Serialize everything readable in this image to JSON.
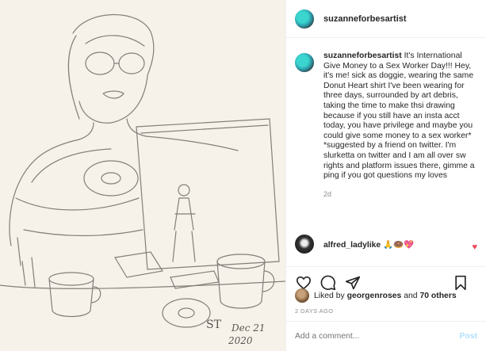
{
  "post": {
    "username": "suzanneforbesartist",
    "caption_user": "suzanneforbesartist",
    "caption_text": "It's International Give Money to a Sex Worker Day!!! Hey, it's me! sick as doggie, wearing the same Donut Heart shirt I've been wearing for three days, surrounded by art debris, taking the time to make thsi drawing because if you still have an insta acct today, you have privilege and maybe you could give some money to a sex worker* *suggested by a friend on twitter. I'm slurketta on twitter and I am all over sw rights and platform issues there, gimme a ping if you got questions my loves",
    "caption_time": "2d"
  },
  "comment": {
    "user": "alfred_ladylike",
    "text": "🙏🍩💖",
    "like_icon": "heart-icon"
  },
  "actions": {
    "like_icon": "heart-outline-icon",
    "comment_icon": "comment-icon",
    "share_icon": "paper-plane-icon",
    "save_icon": "bookmark-icon"
  },
  "likes": {
    "prefix": "Liked by",
    "user": "georgenroses",
    "joiner": "and",
    "others": "70 others"
  },
  "posted": "2 DAYS AGO",
  "add_comment": {
    "placeholder": "Add a comment...",
    "post_label": "Post"
  },
  "artwork": {
    "signature": "ST",
    "date_line1": "Dec 21",
    "date_line2": "2020"
  },
  "colors": {
    "heart": "#ed4956",
    "link_disabled": "#b2dffc",
    "muted": "#8e8e8e"
  }
}
